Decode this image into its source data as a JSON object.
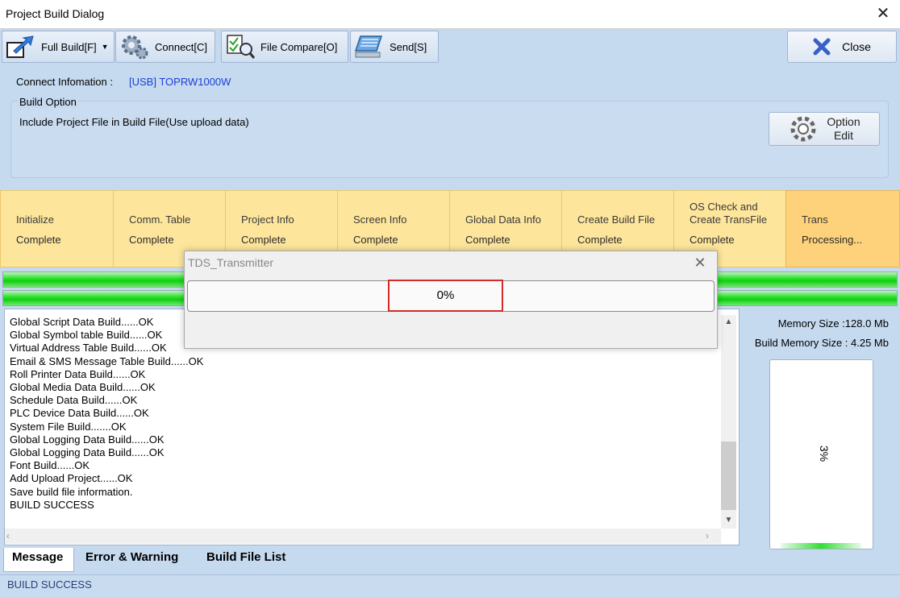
{
  "window": {
    "title": "Project Build Dialog"
  },
  "toolbar": {
    "full_build": "Full Build[F]",
    "connect": "Connect[C]",
    "file_compare": "File Compare[O]",
    "send": "Send[S]",
    "close": "Close"
  },
  "connect_info": {
    "label": "Connect Infomation :",
    "value": "[USB] TOPRW1000W"
  },
  "build_option": {
    "title": "Build Option",
    "description": "Include Project File in Build File(Use upload data)",
    "edit_line1": "Option",
    "edit_line2": "Edit"
  },
  "steps": [
    {
      "name": "Initialize",
      "status": "Complete"
    },
    {
      "name": "Comm. Table",
      "status": "Complete"
    },
    {
      "name": "Project Info",
      "status": "Complete"
    },
    {
      "name": "Screen Info",
      "status": "Complete"
    },
    {
      "name": "Global Data Info",
      "status": "Complete"
    },
    {
      "name": "Create Build File",
      "status": "Complete"
    },
    {
      "name_line1": "OS Check and",
      "name_line2": "Create TransFile",
      "status": "Complete"
    },
    {
      "name": "Trans",
      "status": "Processing..."
    }
  ],
  "log": {
    "lines": [
      "Global Script Data Build......OK",
      "Global Symbol table Build......OK",
      "Virtual Address Table Build......OK",
      "Email & SMS Message Table Build......OK",
      "Roll Printer Data Build......OK",
      "Global Media Data Build......OK",
      "Schedule Data Build......OK",
      "PLC Device Data Build......OK",
      "System File Build.......OK",
      "Global Logging Data Build......OK",
      "Global Logging Data Build......OK",
      "Font Build......OK",
      "Add Upload Project......OK",
      "Save build file information.",
      "BUILD SUCCESS"
    ]
  },
  "tabs": {
    "message": "Message",
    "errors": "Error & Warning",
    "build_files": "Build File List"
  },
  "status": {
    "text": "BUILD SUCCESS"
  },
  "memory": {
    "memory_size": "Memory Size :128.0 Mb",
    "build_memory_size": "Build Memory Size : 4.25 Mb",
    "percent_label": "3%",
    "usage_fraction": 0.03
  },
  "popup": {
    "title": "TDS_Transmitter",
    "progress_label": "0%",
    "progress_fraction": 0.0
  },
  "colors": {
    "step_bg": "#fde59c",
    "step_active_bg": "#fdd27a",
    "progress_green": "#0ed10e",
    "highlight_red": "#d32a2a",
    "link_blue": "#1a3fd6"
  }
}
